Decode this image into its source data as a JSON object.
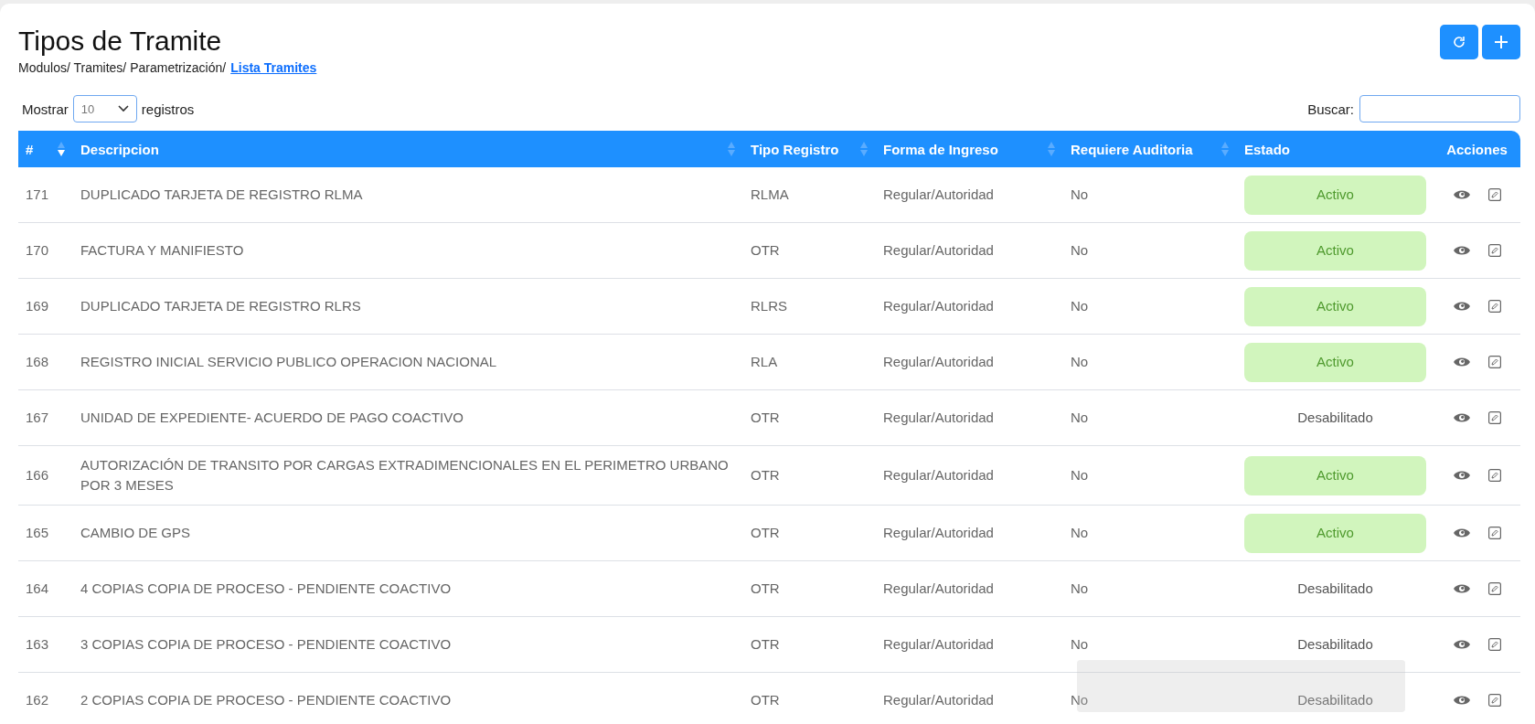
{
  "title": "Tipos de Tramite",
  "breadcrumb": {
    "path": "Modulos/ Tramites/ Parametrización/",
    "current": "Lista Tramites"
  },
  "length_control": {
    "before": "Mostrar",
    "value": "10",
    "after": "registros"
  },
  "search": {
    "label": "Buscar:"
  },
  "table": {
    "columns": [
      {
        "label": "#",
        "sorted_desc": true
      },
      {
        "label": "Descripcion",
        "sorted_desc": false
      },
      {
        "label": "Tipo Registro",
        "sorted_desc": false
      },
      {
        "label": "Forma de Ingreso",
        "sorted_desc": false
      },
      {
        "label": "Requiere Auditoria",
        "sorted_desc": false
      },
      {
        "label": "Estado"
      },
      {
        "label": "Acciones"
      }
    ],
    "rows": [
      {
        "id": "171",
        "descripcion": "DUPLICADO TARJETA DE REGISTRO RLMA",
        "tipo": "RLMA",
        "forma": "Regular/Autoridad",
        "auditoria": "No",
        "estado": "Activo",
        "active": true
      },
      {
        "id": "170",
        "descripcion": "FACTURA Y MANIFIESTO",
        "tipo": "OTR",
        "forma": "Regular/Autoridad",
        "auditoria": "No",
        "estado": "Activo",
        "active": true
      },
      {
        "id": "169",
        "descripcion": "DUPLICADO TARJETA DE REGISTRO RLRS",
        "tipo": "RLRS",
        "forma": "Regular/Autoridad",
        "auditoria": "No",
        "estado": "Activo",
        "active": true
      },
      {
        "id": "168",
        "descripcion": "REGISTRO INICIAL SERVICIO PUBLICO OPERACION NACIONAL",
        "tipo": "RLA",
        "forma": "Regular/Autoridad",
        "auditoria": "No",
        "estado": "Activo",
        "active": true
      },
      {
        "id": "167",
        "descripcion": "UNIDAD DE EXPEDIENTE- ACUERDO DE PAGO COACTIVO",
        "tipo": "OTR",
        "forma": "Regular/Autoridad",
        "auditoria": "No",
        "estado": "Desabilitado",
        "active": false
      },
      {
        "id": "166",
        "descripcion": "AUTORIZACIÓN DE TRANSITO POR CARGAS EXTRADIMENCIONALES EN EL PERIMETRO URBANO POR 3 MESES",
        "tipo": "OTR",
        "forma": "Regular/Autoridad",
        "auditoria": "No",
        "estado": "Activo",
        "active": true
      },
      {
        "id": "165",
        "descripcion": "CAMBIO DE GPS",
        "tipo": "OTR",
        "forma": "Regular/Autoridad",
        "auditoria": "No",
        "estado": "Activo",
        "active": true
      },
      {
        "id": "164",
        "descripcion": "4 COPIAS COPIA DE PROCESO - PENDIENTE COACTIVO",
        "tipo": "OTR",
        "forma": "Regular/Autoridad",
        "auditoria": "No",
        "estado": "Desabilitado",
        "active": false
      },
      {
        "id": "163",
        "descripcion": "3 COPIAS COPIA DE PROCESO - PENDIENTE COACTIVO",
        "tipo": "OTR",
        "forma": "Regular/Autoridad",
        "auditoria": "No",
        "estado": "Desabilitado",
        "active": false
      },
      {
        "id": "162",
        "descripcion": "2 COPIAS COPIA DE PROCESO - PENDIENTE COACTIVO",
        "tipo": "OTR",
        "forma": "Regular/Autoridad",
        "auditoria": "No",
        "estado": "Desabilitado",
        "active": false
      }
    ]
  }
}
